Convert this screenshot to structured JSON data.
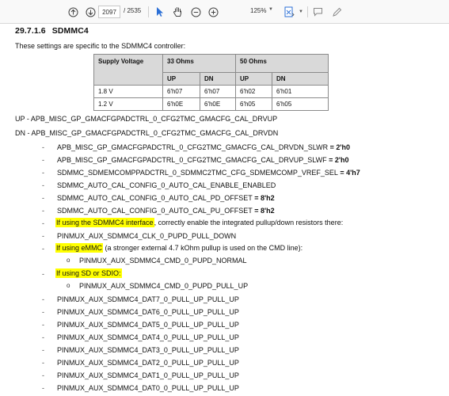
{
  "toolbar": {
    "page_current": "2097",
    "page_total": "/ 2535",
    "zoom": "125%",
    "accent": "#2b6fd6"
  },
  "section": {
    "number": "29.7.1.6",
    "title": "SDMMC4",
    "intro": "These settings are specific to the SDMMC4 controller:"
  },
  "table": {
    "header_row1": [
      "Supply Voltage",
      "33 Ohms",
      "50 Ohms"
    ],
    "header_row2": [
      "UP",
      "DN",
      "UP",
      "DN"
    ],
    "rows": [
      [
        "1.8 V",
        "6'h07",
        "6'h07",
        "6'h02",
        "6'h01"
      ],
      [
        "1.2 V",
        "6'h0E",
        "6'h0E",
        "6'h05",
        "6'h05"
      ]
    ]
  },
  "defs": {
    "up": "UP - APB_MISC_GP_GMACFGPADCTRL_0_CFG2TMC_GMACFG_CAL_DRVUP",
    "dn": "DN - APB_MISC_GP_GMACFGPADCTRL_0_CFG2TMC_GMACFG_CAL_DRVDN"
  },
  "items": {
    "i1_name": "APB_MISC_GP_GMACFGPADCTRL_0_CFG2TMC_GMACFG_CAL_DRVDN_SLWR",
    "i1_val": " = 2'h0",
    "i2_name": "APB_MISC_GP_GMACFGPADCTRL_0_CFG2TMC_GMACFG_CAL_DRVUP_SLWF",
    "i2_val": " = 2'h0",
    "i3_name": "SDMMC_SDMEMCOMPPADCTRL_0_SDMMC2TMC_CFG_SDMEMCOMP_VREF_SEL",
    "i3_val": " = 4'h7",
    "i4": "SDMMC_AUTO_CAL_CONFIG_0_AUTO_CAL_ENABLE_ENABLED",
    "i5_name": "SDMMC_AUTO_CAL_CONFIG_0_AUTO_CAL_PD_OFFSET",
    "i5_val": " = 8'h2",
    "i6_name": "SDMMC_AUTO_CAL_CONFIG_0_AUTO_CAL_PU_OFFSET",
    "i6_val": " = 8'h2",
    "i7_hl": "If using the SDMMC4 interface",
    "i7_rest": ", correctly enable the integrated pullup/down resistors there:",
    "i8": "PINMUX_AUX_SDMMC4_CLK_0_PUPD_PULL_DOWN",
    "i9_hl": "If using eMMC",
    "i9_rest": " (a stronger external 4.7 kOhm pullup is used on the CMD line):",
    "i9_sub": "PINMUX_AUX_SDMMC4_CMD_0_PUPD_NORMAL",
    "i10_hl": "If using SD or SDIO:",
    "i10_sub": "PINMUX_AUX_SDMMC4_CMD_0_PUPD_PULL_UP",
    "dat": [
      "PINMUX_AUX_SDMMC4_DAT7_0_PULL_UP_PULL_UP",
      "PINMUX_AUX_SDMMC4_DAT6_0_PULL_UP_PULL_UP",
      "PINMUX_AUX_SDMMC4_DAT5_0_PULL_UP_PULL_UP",
      "PINMUX_AUX_SDMMC4_DAT4_0_PULL_UP_PULL_UP",
      "PINMUX_AUX_SDMMC4_DAT3_0_PULL_UP_PULL_UP",
      "PINMUX_AUX_SDMMC4_DAT2_0_PULL_UP_PULL_UP",
      "PINMUX_AUX_SDMMC4_DAT1_0_PULL_UP_PULL_UP",
      "PINMUX_AUX_SDMMC4_DAT0_0_PULL_UP_PULL_UP"
    ],
    "dash": "-",
    "circle": "o"
  },
  "highlight_color": "#ffff00"
}
